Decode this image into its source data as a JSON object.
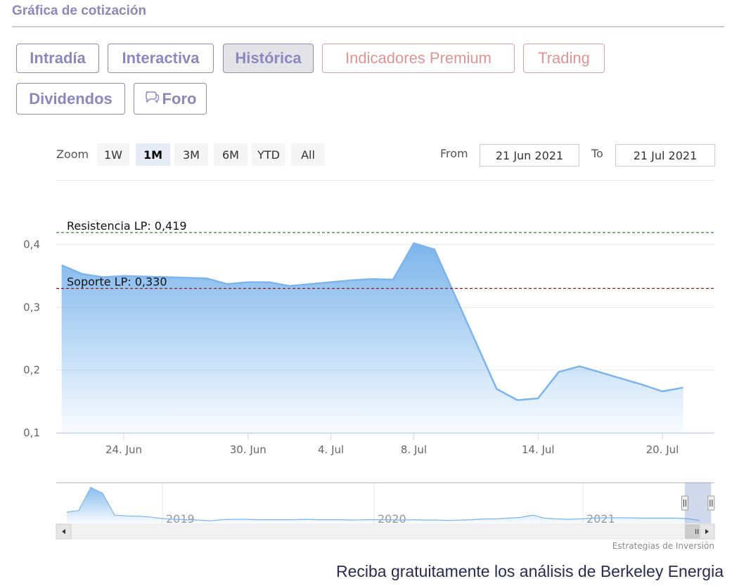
{
  "section": {
    "title": "Gráfica de cotización"
  },
  "tabs": [
    {
      "label": "Intradía",
      "active": false,
      "premium": false
    },
    {
      "label": "Interactiva",
      "active": false,
      "premium": false
    },
    {
      "label": "Histórica",
      "active": true,
      "premium": false
    },
    {
      "label": "Indicadores Premium",
      "active": false,
      "premium": true
    },
    {
      "label": "Trading",
      "active": false,
      "premium": true
    },
    {
      "label": "Dividendos",
      "active": false,
      "premium": false
    },
    {
      "label": "Foro",
      "active": false,
      "premium": false,
      "icon": "speech-bubbles-icon"
    }
  ],
  "range_selector": {
    "zoom_label": "Zoom",
    "buttons": [
      "1W",
      "1M",
      "3M",
      "6M",
      "YTD",
      "All"
    ],
    "selected": "1M",
    "from_label": "From",
    "from_value": "21 Jun 2021",
    "to_label": "To",
    "to_value": "21 Jul 2021"
  },
  "colors": {
    "series_line": "#7cb5ec",
    "resistance": "#2e7d32",
    "support": "#8b1a1a",
    "title": "#8c88bd",
    "premium": "#e09395"
  },
  "chart_data": {
    "type": "area",
    "title": "",
    "xlabel": "",
    "ylabel": "",
    "ylim": [
      0.1,
      0.42
    ],
    "yticks": [
      0.1,
      0.2,
      0.3,
      0.4
    ],
    "ytick_labels": [
      "0,1",
      "0,2",
      "0,3",
      "0,4"
    ],
    "xticks": [
      {
        "date": "2021-06-24",
        "label": "24. Jun"
      },
      {
        "date": "2021-06-30",
        "label": "30. Jun"
      },
      {
        "date": "2021-07-04",
        "label": "4. Jul"
      },
      {
        "date": "2021-07-08",
        "label": "8. Jul"
      },
      {
        "date": "2021-07-14",
        "label": "14. Jul"
      },
      {
        "date": "2021-07-20",
        "label": "20. Jul"
      }
    ],
    "xrange": [
      "2021-06-21",
      "2021-07-21"
    ],
    "grid": true,
    "series": [
      {
        "name": "Berkeley Energia",
        "x": [
          "2021-06-21",
          "2021-06-22",
          "2021-06-23",
          "2021-06-24",
          "2021-06-25",
          "2021-06-28",
          "2021-06-29",
          "2021-06-30",
          "2021-07-01",
          "2021-07-02",
          "2021-07-05",
          "2021-07-06",
          "2021-07-07",
          "2021-07-08",
          "2021-07-09",
          "2021-07-12",
          "2021-07-13",
          "2021-07-14",
          "2021-07-15",
          "2021-07-16",
          "2021-07-19",
          "2021-07-20",
          "2021-07-21"
        ],
        "values": [
          0.367,
          0.353,
          0.348,
          0.35,
          0.349,
          0.346,
          0.337,
          0.34,
          0.34,
          0.334,
          0.343,
          0.345,
          0.344,
          0.402,
          0.392,
          0.17,
          0.152,
          0.155,
          0.197,
          0.206,
          0.177,
          0.166,
          0.172
        ]
      }
    ],
    "plot_lines": [
      {
        "label": "Resistencia LP: 0,419",
        "value": 0.419,
        "style": "dashed",
        "color_key": "resistance"
      },
      {
        "label": "Soporte LP: 0,330",
        "value": 0.33,
        "style": "dashed",
        "color_key": "support"
      }
    ],
    "navigator": {
      "year_labels": [
        "2019",
        "2020",
        "2021"
      ],
      "series_shape": [
        0.3,
        0.34,
        0.95,
        0.8,
        0.22,
        0.2,
        0.19,
        0.17,
        0.13,
        0.11,
        0.1,
        0.09,
        0.07,
        0.1,
        0.11,
        0.11,
        0.1,
        0.1,
        0.1,
        0.1,
        0.11,
        0.1,
        0.1,
        0.1,
        0.09,
        0.1,
        0.1,
        0.1,
        0.09,
        0.1,
        0.09,
        0.09,
        0.08,
        0.09,
        0.1,
        0.12,
        0.12,
        0.14,
        0.16,
        0.22,
        0.14,
        0.12,
        0.11,
        0.12,
        0.14,
        0.15,
        0.15,
        0.15,
        0.14,
        0.14,
        0.14,
        0.14,
        0.13,
        0.08
      ],
      "selected_window": [
        0.955,
        0.995
      ]
    }
  },
  "footer": {
    "credit": "Estrategias de Inversión",
    "cta": "Reciba gratuitamente los análisis de Berkeley Energia"
  }
}
